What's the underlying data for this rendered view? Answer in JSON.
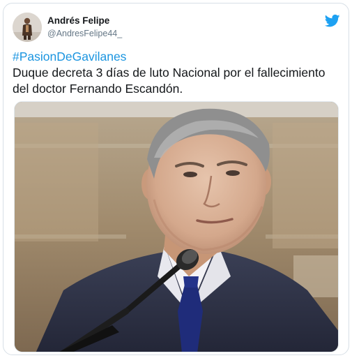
{
  "tweet": {
    "display_name": "Andrés Felipe",
    "handle": "@AndresFelipe44_",
    "hashtag": "#PasionDeGavilanes",
    "text_line1": "Duque decreta 3 días de luto Nacional por el fallecimiento",
    "text_line2": "del doctor Fernando Escandón."
  },
  "icons": {
    "brand": "twitter-bird-icon",
    "avatar": "user-avatar"
  },
  "colors": {
    "hashtag": "#1b95e0",
    "twitter_blue": "#1da1f2",
    "text": "#14171a",
    "handle": "#657786",
    "border": "#d7dfe6"
  }
}
